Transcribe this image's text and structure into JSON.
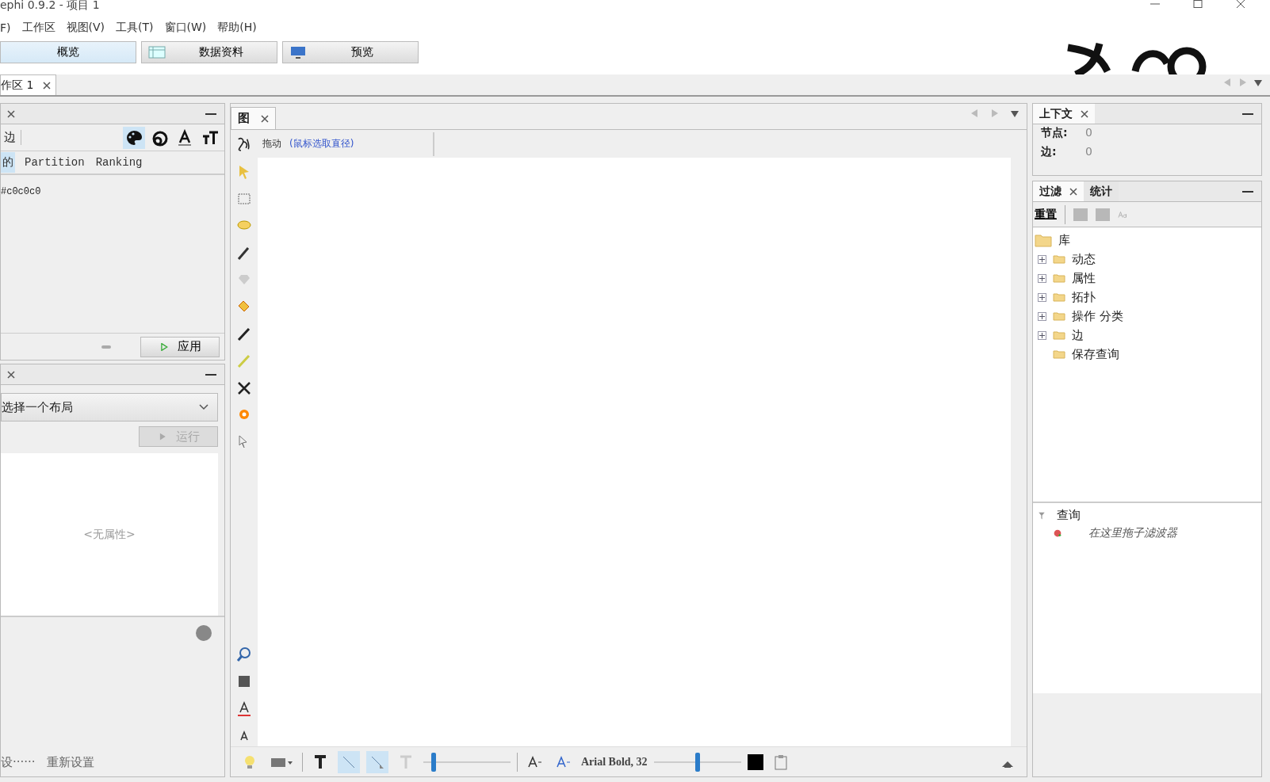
{
  "window": {
    "title": "ephi 0.9.2 - 项目 1"
  },
  "menu": [
    "F)",
    "工作区",
    "视图(V)",
    "工具(T)",
    "窗口(W)",
    "帮助(H)"
  ],
  "workspaces": [
    {
      "label": "概览",
      "selected": true
    },
    {
      "label": "数据资料",
      "selected": false
    },
    {
      "label": "预览",
      "selected": false
    }
  ],
  "document_tabs": [
    {
      "label": "作区 1"
    }
  ],
  "appearance": {
    "tab": "边",
    "subtabs": [
      {
        "label": "的",
        "selected": true
      },
      {
        "label": "Partition",
        "selected": false
      },
      {
        "label": "Ranking",
        "selected": false
      }
    ],
    "color_value": "#c0c0c0",
    "apply": "应用"
  },
  "layout": {
    "select": "选择一个布局",
    "run": "运行",
    "run_disabled": true,
    "empty": "<无属性>",
    "presets": "设······",
    "reset": "重新设置"
  },
  "graph": {
    "tab": "图",
    "mode": "拖动",
    "hint": "(鼠标选取直径)",
    "font": "Arial Bold, 32",
    "sliders": [
      {
        "level": 0.1
      },
      {
        "level": 0.5
      }
    ]
  },
  "context": {
    "tab": "上下文",
    "rows": [
      {
        "label": "节点:",
        "value": "0"
      },
      {
        "label": "边:",
        "value": "0"
      }
    ]
  },
  "filters": {
    "tabs": [
      {
        "label": "过滤",
        "selected": true
      },
      {
        "label": "统计",
        "selected": false
      }
    ],
    "reset": "重置",
    "tree": [
      {
        "label": "库",
        "children": [
          {
            "label": "动态",
            "expanded": false
          },
          {
            "label": "属性",
            "expanded": false
          },
          {
            "label": "拓扑",
            "expanded": false
          },
          {
            "label": "操作 分类",
            "expanded": false
          },
          {
            "label": "边",
            "expanded": false
          },
          {
            "label": "保存查询"
          }
        ]
      }
    ],
    "queries": {
      "title": "查询",
      "drop_hint": "在这里拖子滤波器"
    }
  }
}
